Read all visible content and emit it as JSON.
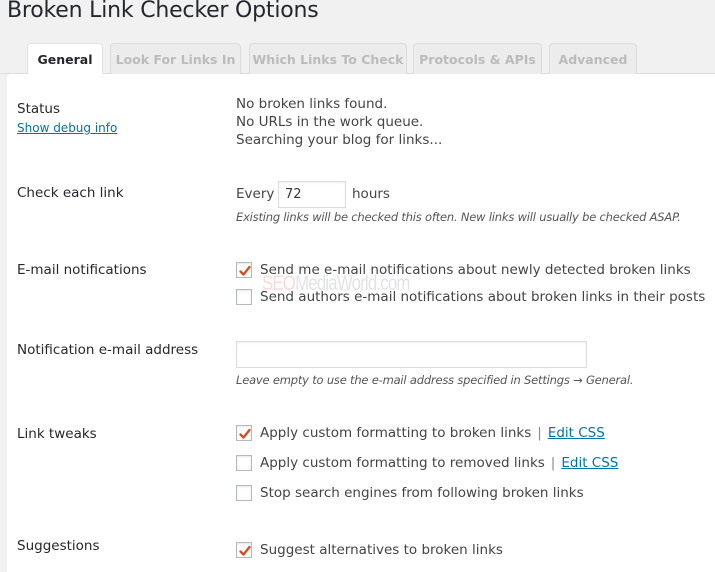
{
  "page": {
    "title": "Broken Link Checker Options"
  },
  "tabs": [
    {
      "label": "General",
      "active": true
    },
    {
      "label": "Look For Links In",
      "active": false
    },
    {
      "label": "Which Links To Check",
      "active": false
    },
    {
      "label": "Protocols & APIs",
      "active": false
    },
    {
      "label": "Advanced",
      "active": false
    }
  ],
  "status": {
    "label": "Status",
    "debug_link": "Show debug info",
    "lines": [
      "No broken links found.",
      "No URLs in the work queue.",
      "Searching your blog for links..."
    ]
  },
  "check_each_link": {
    "label": "Check each link",
    "prefix": "Every",
    "value": "72",
    "suffix": "hours",
    "description": "Existing links will be checked this often. New links will usually be checked ASAP."
  },
  "email_notifications": {
    "label": "E-mail notifications",
    "options": [
      {
        "label": "Send me e-mail notifications about newly detected broken links",
        "checked": true
      },
      {
        "label": "Send authors e-mail notifications about broken links in their posts",
        "checked": false
      }
    ]
  },
  "notification_email": {
    "label": "Notification e-mail address",
    "value": "",
    "placeholder": "",
    "description": "Leave empty to use the e-mail address specified in Settings → General."
  },
  "link_tweaks": {
    "label": "Link tweaks",
    "separator": "|",
    "options": [
      {
        "label": "Apply custom formatting to broken links",
        "checked": true,
        "link": "Edit CSS"
      },
      {
        "label": "Apply custom formatting to removed links",
        "checked": false,
        "link": "Edit CSS"
      },
      {
        "label": "Stop search engines from following broken links",
        "checked": false
      }
    ]
  },
  "suggestions": {
    "label": "Suggestions",
    "options": [
      {
        "label": "Suggest alternatives to broken links",
        "checked": true
      }
    ]
  },
  "watermark": {
    "part1": "SEO",
    "part2": "MediaWorld.com"
  },
  "colors": {
    "link": "#0073aa",
    "check": "#d54e21",
    "background": "#f1f1f1",
    "panel": "#ffffff"
  }
}
